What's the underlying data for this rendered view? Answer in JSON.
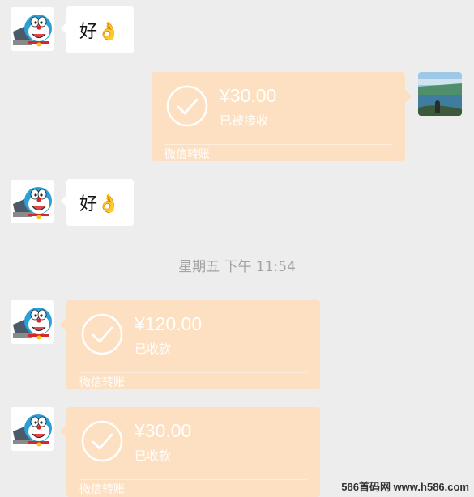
{
  "messages": [
    {
      "type": "text",
      "side": "left",
      "text": "好👌"
    },
    {
      "type": "transfer",
      "side": "right",
      "amount": "¥30.00",
      "status": "已被接收",
      "footer": "微信转账"
    },
    {
      "type": "text",
      "side": "left",
      "text": "好👌"
    },
    {
      "type": "transfer",
      "side": "left",
      "amount": "¥120.00",
      "status": "已收款",
      "footer": "微信转账"
    },
    {
      "type": "transfer",
      "side": "left",
      "amount": "¥30.00",
      "status": "已收款",
      "footer": "微信转账"
    }
  ],
  "timestamp": "星期五 下午 11:54",
  "watermark": "586首码网 www.h586.com",
  "colors": {
    "background": "#ededed",
    "transfer_bubble": "#fde0c2",
    "text_bubble": "#ffffff",
    "timestamp": "#a3a3a3"
  },
  "icons": {
    "avatar_left": "doraemon-avatar-icon",
    "avatar_right": "landscape-photo-avatar",
    "transfer_status": "check-circle-icon"
  }
}
